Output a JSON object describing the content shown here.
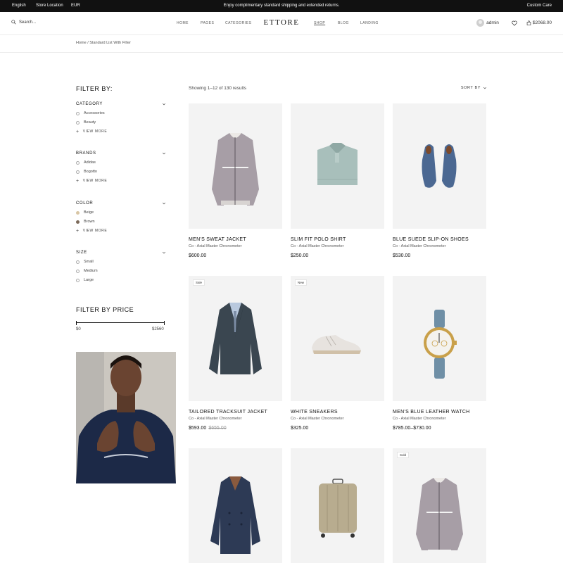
{
  "topbar": {
    "language": "English",
    "store_location": "Store Location",
    "currency": "EUR",
    "promo": "Enjoy complimentary standard shipping and extended returns.",
    "custom_care": "Custom Care"
  },
  "header": {
    "search_placeholder": "Search...",
    "nav": [
      "HOME",
      "PAGES",
      "CATEGORIES",
      "SHOP",
      "BLOG",
      "LANDING"
    ],
    "active_nav": "SHOP",
    "logo": "ETTORE",
    "user": "admin",
    "cart_total": "$2068.00"
  },
  "breadcrumb": {
    "home": "Home",
    "sep": "/",
    "current": "Standard List With Filter"
  },
  "sidebar": {
    "title": "FILTER BY:",
    "groups": [
      {
        "label": "CATEGORY",
        "items": [
          "Accessories",
          "Beauty"
        ],
        "more": "VIEW MORE"
      },
      {
        "label": "BRANDS",
        "items": [
          "Adidas",
          "Bogotto"
        ],
        "more": "VIEW MORE"
      },
      {
        "label": "COLOR",
        "items": [
          "Beige",
          "Brown"
        ],
        "swatches": [
          "#d9c6a5",
          "#7c6a5a"
        ],
        "more": "VIEW MORE"
      },
      {
        "label": "SIZE",
        "items": [
          "Small",
          "Medium",
          "Large"
        ]
      }
    ],
    "price_title": "FILTER BY PRICE",
    "price_min": "$0",
    "price_max": "$2560"
  },
  "results": {
    "showing": "Showing 1–12 of 130 results",
    "sort_label": "SORT BY"
  },
  "products": [
    {
      "name": "MEN'S SWEAT JACKET",
      "brand": "Co - Axial Master Chronometer",
      "price": "$600.00",
      "old_price": "",
      "badge": ""
    },
    {
      "name": "SLIM FIT POLO SHIRT",
      "brand": "Co - Axial Master Chronometer",
      "price": "$250.00",
      "old_price": "",
      "badge": ""
    },
    {
      "name": "BLUE SUEDE SLIP-ON SHOES",
      "brand": "Co - Axial Master Chronometer",
      "price": "$530.00",
      "old_price": "",
      "badge": ""
    },
    {
      "name": "TAILORED TRACKSUIT JACKET",
      "brand": "Co - Axial Master Chronometer",
      "price": "$593.00",
      "old_price": "$655.00",
      "badge": "Sale"
    },
    {
      "name": "WHITE SNEAKERS",
      "brand": "Co - Axial Master Chronometer",
      "price": "$325.00",
      "old_price": "",
      "badge": "New"
    },
    {
      "name": "MEN'S BLUE LEATHER WATCH",
      "brand": "Co - Axial Master Chronometer",
      "price": "$785.00–$730.00",
      "old_price": "",
      "badge": ""
    },
    {
      "name": "",
      "brand": "",
      "price": "",
      "old_price": "",
      "badge": ""
    },
    {
      "name": "",
      "brand": "",
      "price": "",
      "old_price": "",
      "badge": ""
    },
    {
      "name": "",
      "brand": "",
      "price": "",
      "old_price": "",
      "badge": "Sold"
    }
  ]
}
